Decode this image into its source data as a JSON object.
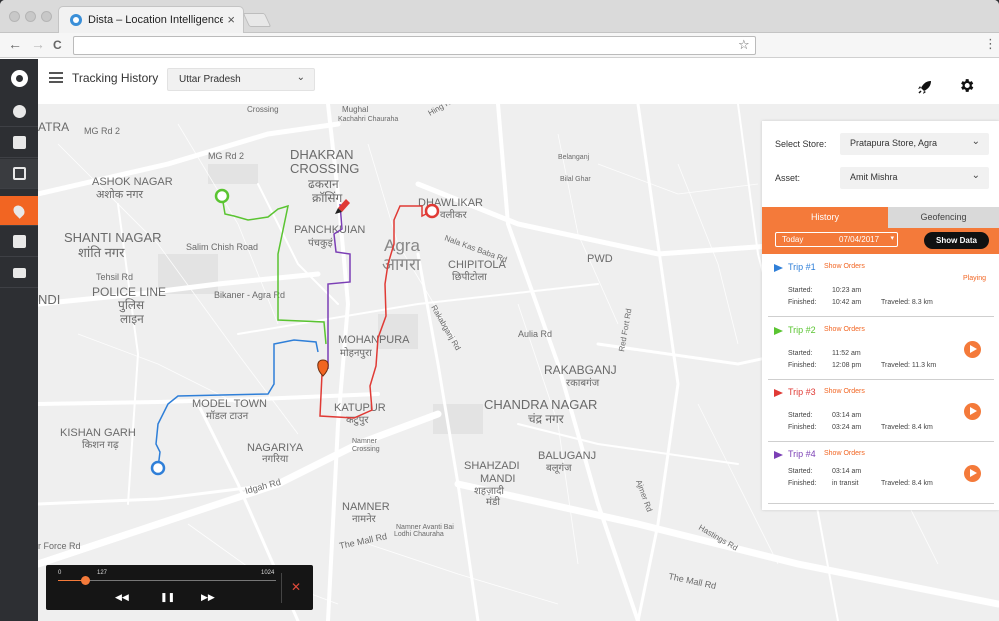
{
  "browser": {
    "tab_title": "Dista – Location Intelligence Pl",
    "tab_close": "×",
    "back": "←",
    "forward": "→",
    "reload": "C",
    "star": "☆",
    "menu": "⋮"
  },
  "sidebar": {
    "items": [
      {
        "icon": "check-circle-icon"
      },
      {
        "icon": "store-icon"
      },
      {
        "icon": "grid-icon"
      },
      {
        "icon": "location-pin-icon",
        "active": true
      },
      {
        "icon": "building-icon"
      },
      {
        "icon": "monitor-icon"
      }
    ]
  },
  "header": {
    "title": "Tracking History",
    "region": "Uttar Pradesh",
    "chevron": "⌄"
  },
  "panel": {
    "store_label": "Select Store:",
    "store_value": "Pratapura Store, Agra",
    "asset_label": "Asset:",
    "asset_value": "Amit Mishra",
    "tab_history": "History",
    "tab_geofencing": "Geofencing",
    "date_label": "Today",
    "date_value": "07/04/2017",
    "date_caret": "▾",
    "show_data": "Show Data",
    "trips": [
      {
        "name": "Trip #1",
        "color": "#2f7fd8",
        "orders": "Show Orders",
        "started_label": "Started:",
        "started": "10:23 am",
        "finished_label": "Finished:",
        "finished": "10:42 am",
        "traveled": "Traveled: 8.3 km",
        "status": "Playing"
      },
      {
        "name": "Trip #2",
        "color": "#5ac431",
        "orders": "Show Orders",
        "started_label": "Started:",
        "started": "11:52 am",
        "finished_label": "Finished:",
        "finished": "12:08 pm",
        "traveled": "Traveled: 11.3 km"
      },
      {
        "name": "Trip #3",
        "color": "#e03a35",
        "orders": "Show Orders",
        "started_label": "Started:",
        "started": "03:14 am",
        "finished_label": "Finished:",
        "finished": "03:24 am",
        "traveled": "Traveled: 8.4 km"
      },
      {
        "name": "Trip #4",
        "color": "#7b3fb5",
        "orders": "Show Orders",
        "started_label": "Started:",
        "started": "03:14 am",
        "finished_label": "Finished:",
        "finished": "in transit",
        "traveled": "Traveled: 8.4 km"
      }
    ]
  },
  "player": {
    "min": "0",
    "current": "127",
    "max": "1024",
    "progress": 0.124,
    "rewind": "◀◀",
    "pause": "❚❚",
    "forward": "▶▶",
    "close": "✕"
  },
  "map": {
    "labels": [
      {
        "text": "ATRA",
        "cls": "big"
      },
      {
        "text": "DHAKRAN",
        "cls": "big"
      },
      {
        "text": "CROSSING",
        "cls": "big"
      },
      {
        "text": "ढकरान",
        "cls": "big"
      },
      {
        "text": "क्रॉसिंग",
        "cls": "big"
      },
      {
        "text": "ASHOK NAGAR",
        "cls": "med"
      },
      {
        "text": "अशोक नगर",
        "cls": "med"
      },
      {
        "text": "SHANTI NAGAR",
        "cls": "big"
      },
      {
        "text": "शांति नगर",
        "cls": "big"
      },
      {
        "text": "PANCHKUIAN",
        "cls": "med"
      },
      {
        "text": "पंचकुइं",
        "cls": "med"
      },
      {
        "text": "DHAWLIKAR",
        "cls": "med"
      },
      {
        "text": "वलीकर",
        "cls": "med"
      },
      {
        "text": "Agra",
        "cls": "city"
      },
      {
        "text": "आगरा",
        "cls": "city"
      },
      {
        "text": "CHIPITOLA",
        "cls": "med"
      },
      {
        "text": "छिपीटोला",
        "cls": "med"
      },
      {
        "text": "PWD",
        "cls": "med"
      },
      {
        "text": "POLICE LINE",
        "cls": "big"
      },
      {
        "text": "पुलिस",
        "cls": "big"
      },
      {
        "text": "लाइन",
        "cls": "big"
      },
      {
        "text": "NDI",
        "cls": "big"
      },
      {
        "text": "MOHANPURA",
        "cls": "med"
      },
      {
        "text": "मोहनपुरा",
        "cls": "med"
      },
      {
        "text": "RAKABGANJ",
        "cls": "big"
      },
      {
        "text": "रकाबगंज",
        "cls": "med"
      },
      {
        "text": "MODEL TOWN",
        "cls": "med"
      },
      {
        "text": "मॉडल टाउन",
        "cls": "med"
      },
      {
        "text": "KATUPUR",
        "cls": "med"
      },
      {
        "text": "कटुपुर",
        "cls": "med"
      },
      {
        "text": "CHANDRA NAGAR",
        "cls": "big"
      },
      {
        "text": "चंद्र नगर",
        "cls": "big"
      },
      {
        "text": "KISHAN GARH",
        "cls": "med"
      },
      {
        "text": "किशन गढ़",
        "cls": "med"
      },
      {
        "text": "NAGARIYA",
        "cls": "med"
      },
      {
        "text": "नगरिया",
        "cls": "med"
      },
      {
        "text": "BALUGANJ",
        "cls": "med"
      },
      {
        "text": "बलूगंज",
        "cls": "med"
      },
      {
        "text": "SHAHZADI",
        "cls": "med"
      },
      {
        "text": "MANDI",
        "cls": "med"
      },
      {
        "text": "शहज़ादी",
        "cls": "med"
      },
      {
        "text": "मंडी",
        "cls": "med"
      },
      {
        "text": "NAMNER",
        "cls": "med"
      },
      {
        "text": "नामनेर",
        "cls": "med"
      },
      {
        "text": "MG Rd 2",
        "cls": "road"
      },
      {
        "text": "MG Rd 2",
        "cls": "road"
      },
      {
        "text": "Salim Chish Road",
        "cls": "road"
      },
      {
        "text": "Tehsil Rd",
        "cls": "road"
      },
      {
        "text": "Bikaner - Agra Rd",
        "cls": "road"
      },
      {
        "text": "Idgah Rd",
        "cls": "road"
      },
      {
        "text": "Aulia Rd",
        "cls": "road"
      },
      {
        "text": "Red Fort Rd",
        "cls": "road"
      },
      {
        "text": "Rakabganj Rd",
        "cls": "road"
      },
      {
        "text": "Nala Kas Baba Rd",
        "cls": "road"
      },
      {
        "text": "The Mall Rd",
        "cls": "road"
      },
      {
        "text": "The Mall Rd",
        "cls": "road"
      },
      {
        "text": "Hastings Rd",
        "cls": "road"
      },
      {
        "text": "r Force Rd",
        "cls": "road"
      },
      {
        "text": "Crossing",
        "cls": "small"
      },
      {
        "text": "Mughal",
        "cls": "small"
      },
      {
        "text": "Bilal Ghar",
        "cls": "small"
      },
      {
        "text": "Namner",
        "cls": "small"
      },
      {
        "text": "Crossing",
        "cls": "small"
      },
      {
        "text": "Namner Avanti Bai",
        "cls": "small"
      },
      {
        "text": "Lodhi Chauraha",
        "cls": "small"
      },
      {
        "text": "Hing Ki Mandi",
        "cls": "road"
      },
      {
        "text": "Kachahri Chauraha",
        "cls": "small"
      },
      {
        "text": "Belanganj",
        "cls": "small"
      },
      {
        "text": "Ajmer Rd",
        "cls": "road"
      }
    ]
  }
}
